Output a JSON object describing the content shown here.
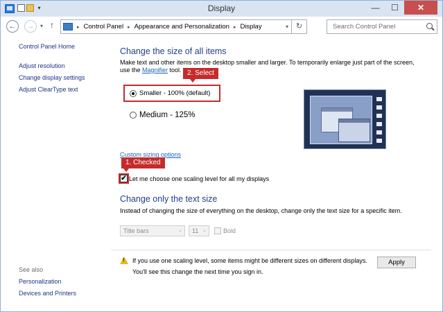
{
  "window": {
    "title": "Display",
    "min_glyph": "—",
    "max_glyph": "☐",
    "close_glyph": "✕"
  },
  "nav": {
    "back_glyph": "←",
    "forward_glyph": "→",
    "dropdown_glyph": "▾",
    "up_glyph": "↑",
    "refresh_glyph": "↻",
    "breadcrumb": [
      "Control Panel",
      "Appearance and Personalization",
      "Display"
    ],
    "breadcrumb_sep": "▸",
    "search_placeholder": "Search Control Panel"
  },
  "sidebar": {
    "home": "Control Panel Home",
    "links": [
      "Adjust resolution",
      "Change display settings",
      "Adjust ClearType text"
    ],
    "see_also_label": "See also",
    "see_also_links": [
      "Personalization",
      "Devices and Printers"
    ]
  },
  "main": {
    "section1_heading": "Change the size of all items",
    "section1_desc_part1": "Make text and other items on the desktop smaller and larger. To temporarily enlarge just part of the screen, use the ",
    "section1_desc_link": "Magnifier",
    "section1_desc_part2": " tool.",
    "options": [
      {
        "label": "Smaller - 100% (default)",
        "selected": true
      },
      {
        "label": "Medium - 125%",
        "selected": false
      }
    ],
    "custom_sizing_link": "Custom sizing options",
    "one_scaling_checkbox": {
      "label": "Let me choose one scaling level for all my displays",
      "checked": true,
      "glyph": "✔"
    },
    "section2_heading": "Change only the text size",
    "section2_desc": "Instead of changing the size of everything on the desktop, change only the text size for a specific item.",
    "text_item_select": "Title bars",
    "text_size_select": "11",
    "bold_label": "Bold",
    "combo_arrow": "⌄",
    "warning_line1": "If you use one scaling level, some items might be different sizes on different displays.",
    "warning_line2": "You'll see this change the next time you sign in.",
    "warning_mark": "!",
    "apply_label": "Apply"
  },
  "annotations": {
    "callout_select": "2. Select",
    "callout_checked": "1. Checked",
    "color": "#c42c2c"
  }
}
